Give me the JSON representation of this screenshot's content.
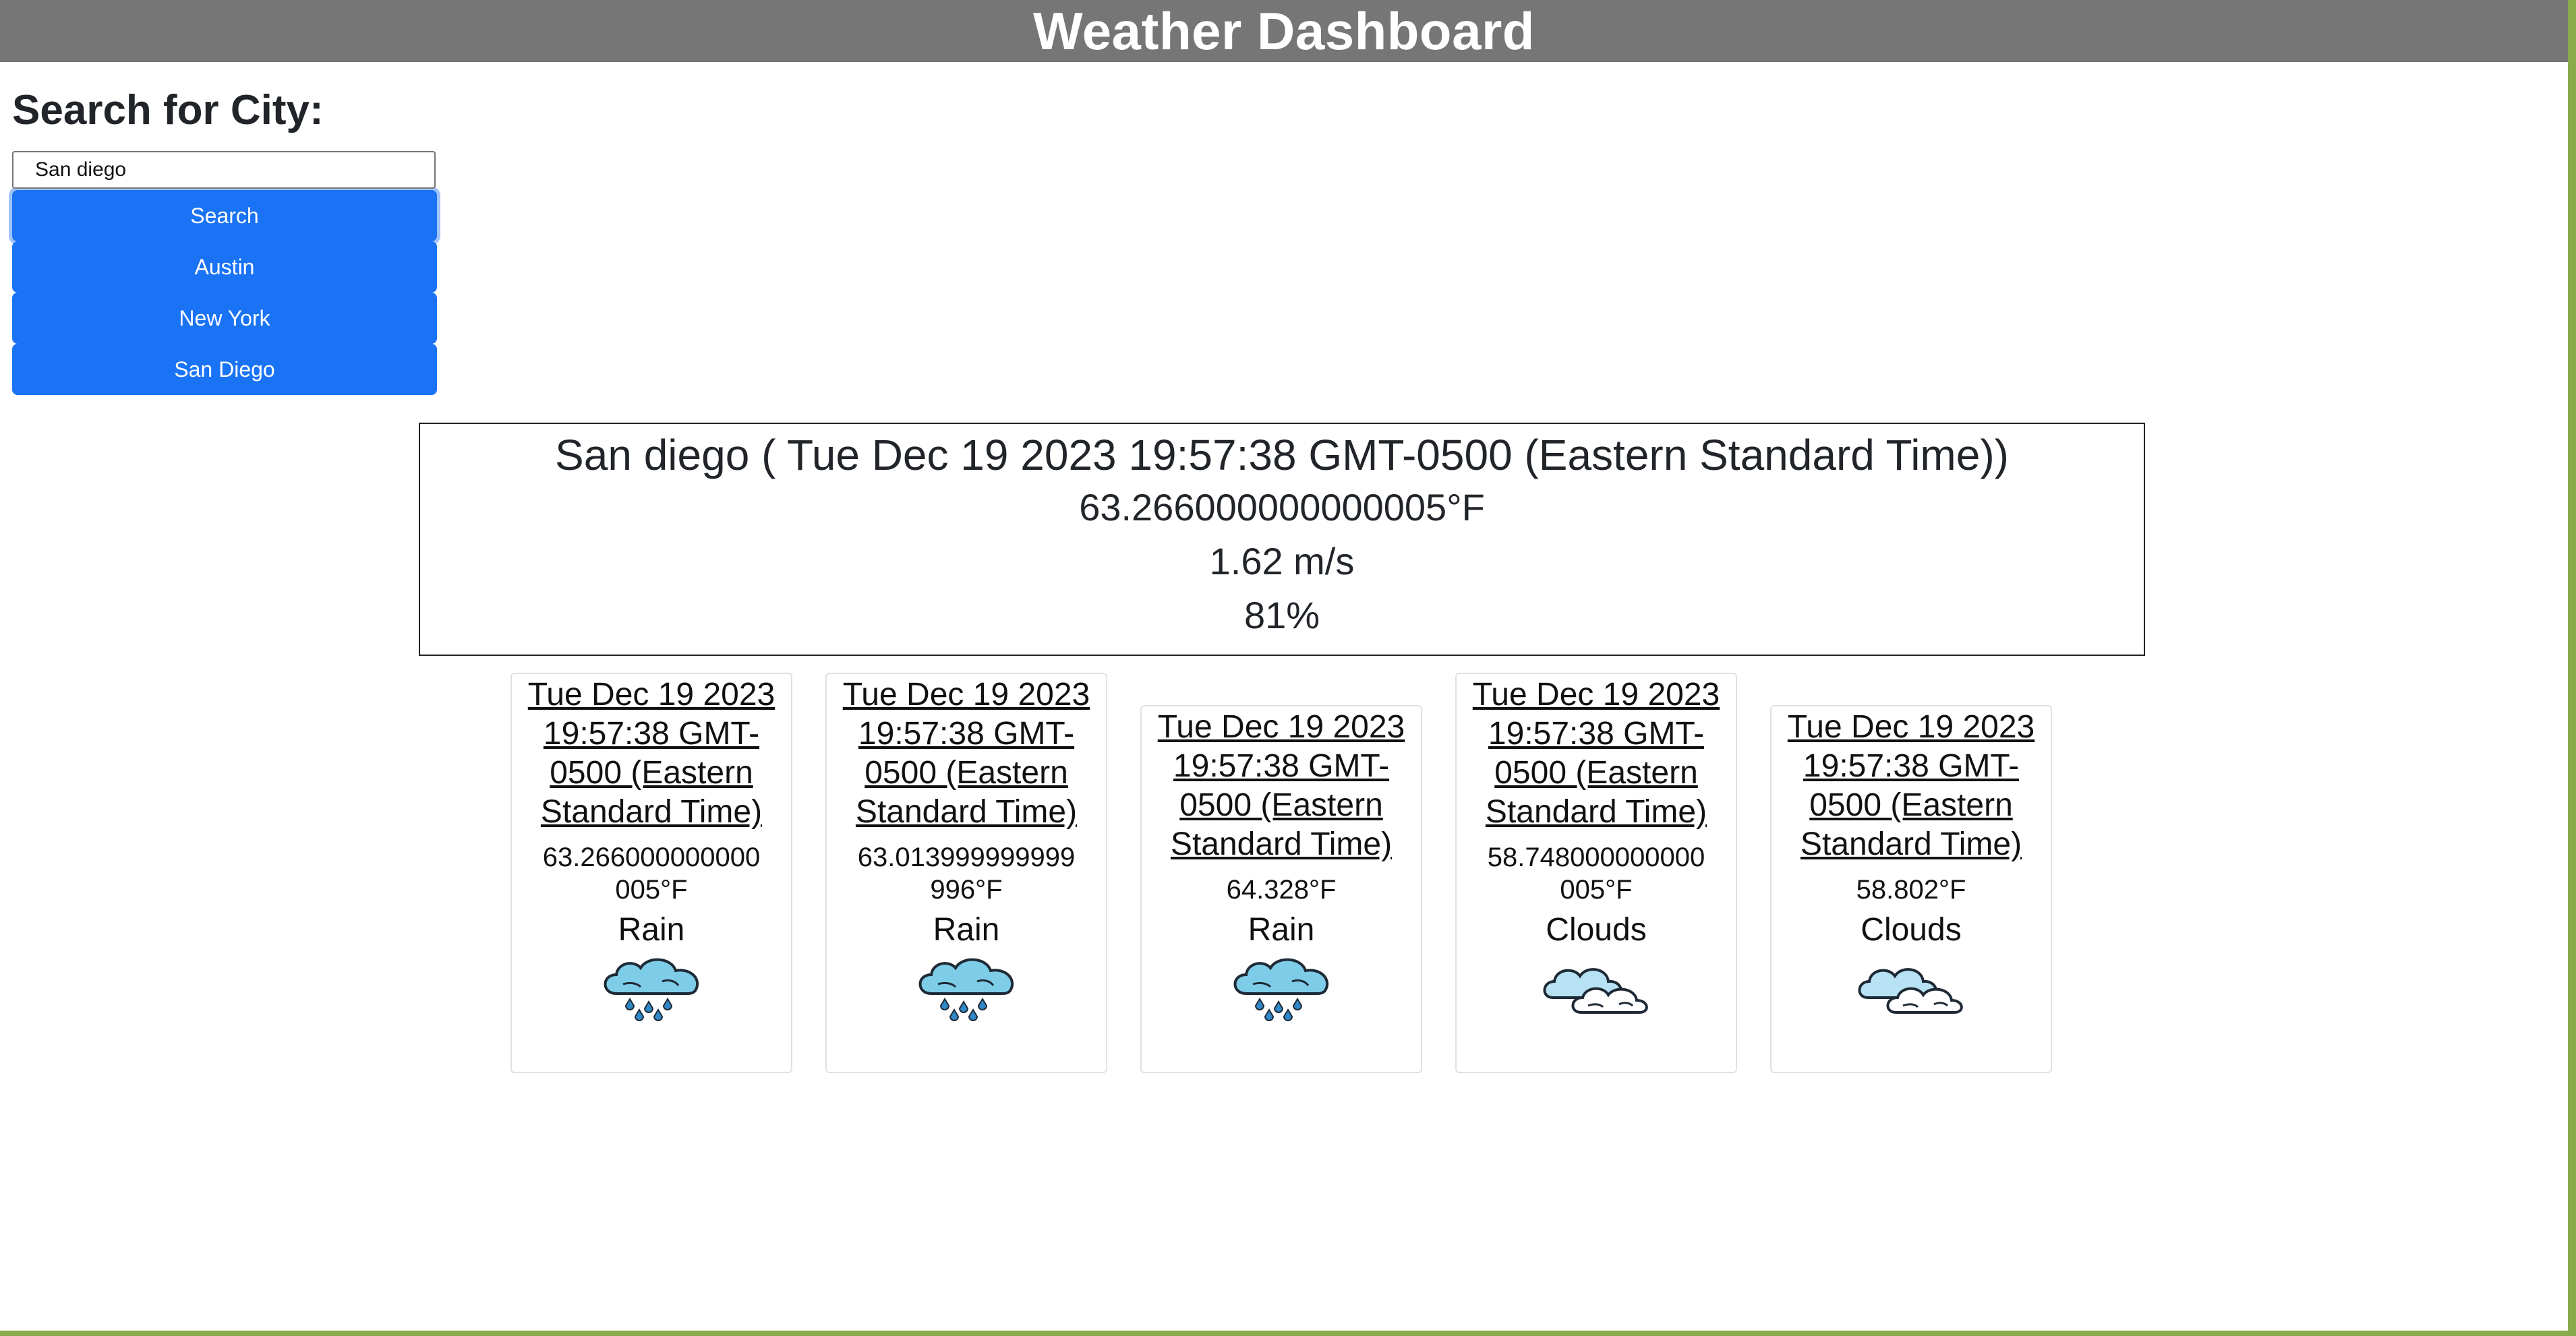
{
  "header": {
    "title": "Weather Dashboard"
  },
  "search": {
    "heading": "Search for City:",
    "input_value": "San diego",
    "button_label": "Search"
  },
  "history": [
    {
      "label": "Austin"
    },
    {
      "label": "New York"
    },
    {
      "label": "San Diego"
    }
  ],
  "current": {
    "title": "San diego ( Tue Dec 19 2023 19:57:38 GMT-0500 (Eastern Standard Time))",
    "temperature": "63.266000000000005°F",
    "wind": "1.62 m/s",
    "humidity": "81%"
  },
  "forecast": [
    {
      "date": "Tue Dec 19 2023 19:57:38 GMT-0500 (Eastern Standard Time)",
      "temp": "63.266000000000005°F",
      "condition": "Rain",
      "icon": "rain-cloud-icon"
    },
    {
      "date": "Tue Dec 19 2023 19:57:38 GMT-0500 (Eastern Standard Time)",
      "temp": "63.013999999999996°F",
      "condition": "Rain",
      "icon": "rain-cloud-icon"
    },
    {
      "date": "Tue Dec 19 2023 19:57:38 GMT-0500 (Eastern Standard Time)",
      "temp": "64.328°F",
      "condition": "Rain",
      "icon": "rain-cloud-icon"
    },
    {
      "date": "Tue Dec 19 2023 19:57:38 GMT-0500 (Eastern Standard Time)",
      "temp": "58.748000000000005°F",
      "condition": "Clouds",
      "icon": "clouds-icon"
    },
    {
      "date": "Tue Dec 19 2023 19:57:38 GMT-0500 (Eastern Standard Time)",
      "temp": "58.802°F",
      "condition": "Clouds",
      "icon": "clouds-icon"
    }
  ],
  "colors": {
    "header_bg": "#767676",
    "button_bg": "#1a73f5",
    "frame_accent": "#8aab4c",
    "icon_fill": "#7ecde8"
  }
}
